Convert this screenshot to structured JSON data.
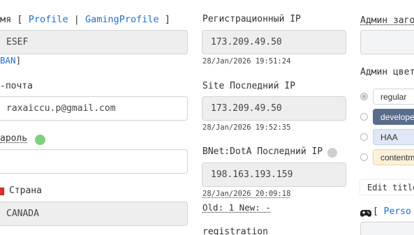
{
  "col1": {
    "name_label_tail": "мя",
    "bracket_open": "[",
    "profile_link": "Profile",
    "separator": "|",
    "gaming_profile_link": "GamingProfile",
    "bracket_close": "]",
    "name_value": "ESEF",
    "ban_link": "BAN",
    "ban_bracket": "]",
    "email_label": "-почта",
    "email_value": "raxaiccu.p@gmail.com",
    "password_label": "ароль",
    "password_value": "",
    "country_label": "Страна",
    "country_value": "CANADA"
  },
  "col2": {
    "reg_ip_label": "Регистрационный IP",
    "reg_ip_value": "173.209.49.50",
    "reg_ip_time": "28/Jan/2026 19:51:24",
    "site_ip_label": "Site Последний IP",
    "site_ip_value": "173.209.49.50",
    "site_ip_time": "28/Jan/2026 19:52:35",
    "bnet_ip_label": "BNet:DotA Последний IP",
    "bnet_ip_value": "198.163.193.159",
    "bnet_ip_time": "28/Jan/2026 20:09:18",
    "old_new_text": "Old: 1 New: -",
    "registration_label": "registration"
  },
  "col3": {
    "admin_title_label": "Админ заго",
    "admin_title_value": "",
    "admin_color_label": "Админ цвет",
    "colors": [
      {
        "label": "regular",
        "checked": true,
        "bg": "#ffffff",
        "fg": "#333333",
        "border": "#cfd4da"
      },
      {
        "label": "developer",
        "checked": false,
        "bg": "#5a6c8c",
        "fg": "#ffffff",
        "border": "#5a6c8c"
      },
      {
        "label": "HAA",
        "checked": false,
        "bg": "#dfe6f7",
        "fg": "#333333",
        "border": "#c6d0ea"
      },
      {
        "label": "contentma",
        "checked": false,
        "bg": "#fbf0d8",
        "fg": "#333333",
        "border": "#e8d4a6"
      }
    ],
    "edit_title_label": "Edit title",
    "personal_bracket": "[",
    "personal_link": "Perso"
  },
  "status": {
    "password_dot_color": "#7ed07e",
    "bnet_dot_color": "#cfcfcf"
  }
}
